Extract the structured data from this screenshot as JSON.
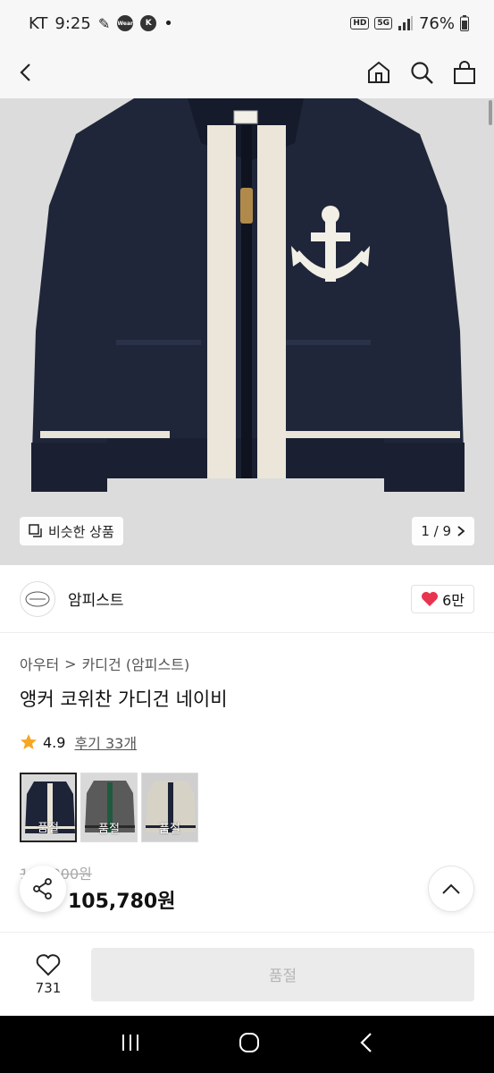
{
  "status_bar": {
    "carrier": "KT",
    "time": "9:25",
    "badge_wear": "Wear",
    "badge_k": "K",
    "dot": "•",
    "hd": "HD",
    "network": "5G",
    "battery": "76%"
  },
  "nav": {
    "back_icon": "chevron-left-icon",
    "home_icon": "home-icon",
    "search_icon": "search-icon",
    "cart_icon": "shopping-bag-icon"
  },
  "gallery": {
    "similar_label": "비슷한 상품",
    "page_indicator": "1 / 9"
  },
  "brand": {
    "name": "암피스트",
    "likes": "6만"
  },
  "product": {
    "breadcrumb_1": "아우터",
    "breadcrumb_sep": ">",
    "breadcrumb_2": "카디건 (암피스트)",
    "title": "앵커 코위찬 가디건 네이비",
    "rating": "4.9",
    "reviews": "후기 33개",
    "original_price": "129,000원",
    "sale_price": "105,780원"
  },
  "thumbnails": [
    {
      "label": "품절",
      "color": "#1d2438"
    },
    {
      "label": "품절",
      "color": "#5a5a5a"
    },
    {
      "label": "품절",
      "color": "#d7d2c6"
    }
  ],
  "bottom_bar": {
    "wish_count": "731",
    "buy_label": "품절"
  },
  "colors": {
    "accent_heart": "#e8344e",
    "star": "#f5a623",
    "navy": "#1d2438"
  }
}
